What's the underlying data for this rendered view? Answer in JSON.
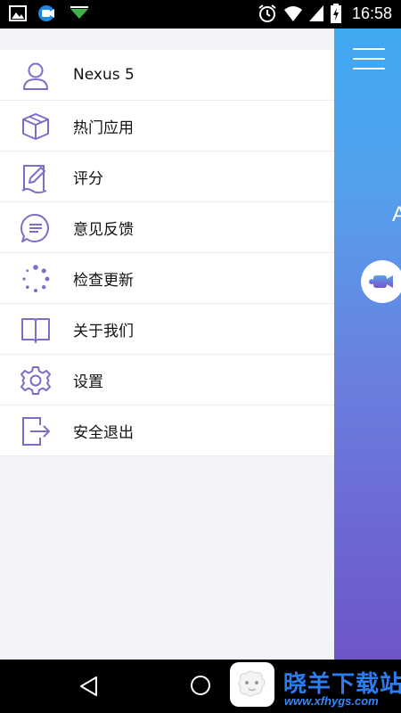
{
  "status_bar": {
    "time": "16:58",
    "left_icons": [
      "image-icon",
      "camera-app-icon",
      "download-icon"
    ],
    "right_icons": [
      "alarm-icon",
      "wifi-icon",
      "signal-icon",
      "battery-icon"
    ]
  },
  "app": {
    "partial_text": "A",
    "accent_colors": {
      "gradient_top": "#3ea8f0",
      "gradient_bottom": "#6e55c8",
      "icon_stroke": "#7a70c8"
    }
  },
  "drawer": {
    "items": [
      {
        "label": "Nexus 5",
        "icon": "user-icon"
      },
      {
        "label": "热门应用",
        "icon": "box-icon"
      },
      {
        "label": "评分",
        "icon": "rate-icon"
      },
      {
        "label": "意见反馈",
        "icon": "feedback-icon"
      },
      {
        "label": "检查更新",
        "icon": "update-icon"
      },
      {
        "label": "关于我们",
        "icon": "book-icon"
      },
      {
        "label": "设置",
        "icon": "gear-icon"
      },
      {
        "label": "安全退出",
        "icon": "exit-icon"
      }
    ]
  },
  "watermark": {
    "title": "晓羊下载站",
    "url": "www.xfhygs.com"
  }
}
